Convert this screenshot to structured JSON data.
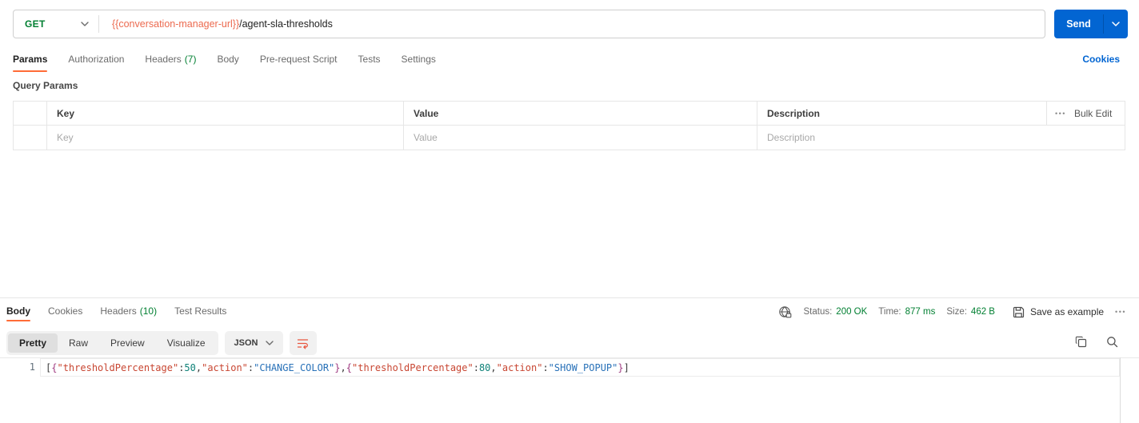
{
  "colors": {
    "accent_orange": "#FF6C37",
    "method_green": "#007F31",
    "success_green": "#007F31",
    "primary_blue": "#0265D2",
    "variable_orange": "#EC6A4F",
    "json_key": "#C84632",
    "json_string": "#2871B8",
    "json_number": "#0F8278",
    "json_brace": "#A03C82"
  },
  "request": {
    "method": "GET",
    "url": {
      "variable": "{{conversation-manager-url}}",
      "path": "/agent-sla-thresholds"
    },
    "send_label": "Send",
    "cookies_link": "Cookies",
    "tabs": [
      {
        "label": "Params"
      },
      {
        "label": "Authorization"
      },
      {
        "label": "Headers",
        "count": "(7)"
      },
      {
        "label": "Body"
      },
      {
        "label": "Pre-request Script"
      },
      {
        "label": "Tests"
      },
      {
        "label": "Settings"
      }
    ],
    "query_params": {
      "title": "Query Params",
      "columns": {
        "key": "Key",
        "value": "Value",
        "description": "Description"
      },
      "bulk_edit": "Bulk Edit",
      "more_icon": "•••",
      "placeholders": {
        "key": "Key",
        "value": "Value",
        "description": "Description"
      }
    }
  },
  "response": {
    "tabs": [
      {
        "label": "Body"
      },
      {
        "label": "Cookies"
      },
      {
        "label": "Headers",
        "count": "(10)"
      },
      {
        "label": "Test Results"
      }
    ],
    "meta": {
      "status_label": "Status:",
      "status_value": "200 OK",
      "time_label": "Time:",
      "time_value": "877 ms",
      "size_label": "Size:",
      "size_value": "462 B",
      "save_as_example_label": "Save as example",
      "more_icon": "•••"
    },
    "toolbar": {
      "view_modes": [
        "Pretty",
        "Raw",
        "Preview",
        "Visualize"
      ],
      "active_view": "Pretty",
      "format": "JSON"
    },
    "body": {
      "line_number": "1",
      "raw_text": "[{\"thresholdPercentage\":50,\"action\":\"CHANGE_COLOR\"},{\"thresholdPercentage\":80,\"action\":\"SHOW_POPUP\"}]",
      "tokens": [
        {
          "text": "[",
          "type": "bracket"
        },
        {
          "text": "{",
          "type": "brace"
        },
        {
          "text": "\"thresholdPercentage\"",
          "type": "key"
        },
        {
          "text": ":",
          "type": "punct"
        },
        {
          "text": "50",
          "type": "number"
        },
        {
          "text": ",",
          "type": "punct"
        },
        {
          "text": "\"action\"",
          "type": "key"
        },
        {
          "text": ":",
          "type": "punct"
        },
        {
          "text": "\"CHANGE_COLOR\"",
          "type": "string"
        },
        {
          "text": "}",
          "type": "brace"
        },
        {
          "text": ",",
          "type": "punct"
        },
        {
          "text": "{",
          "type": "brace"
        },
        {
          "text": "\"thresholdPercentage\"",
          "type": "key"
        },
        {
          "text": ":",
          "type": "punct"
        },
        {
          "text": "80",
          "type": "number"
        },
        {
          "text": ",",
          "type": "punct"
        },
        {
          "text": "\"action\"",
          "type": "key"
        },
        {
          "text": ":",
          "type": "punct"
        },
        {
          "text": "\"SHOW_POPUP\"",
          "type": "string"
        },
        {
          "text": "}",
          "type": "brace"
        },
        {
          "text": "]",
          "type": "bracket"
        }
      ]
    }
  }
}
